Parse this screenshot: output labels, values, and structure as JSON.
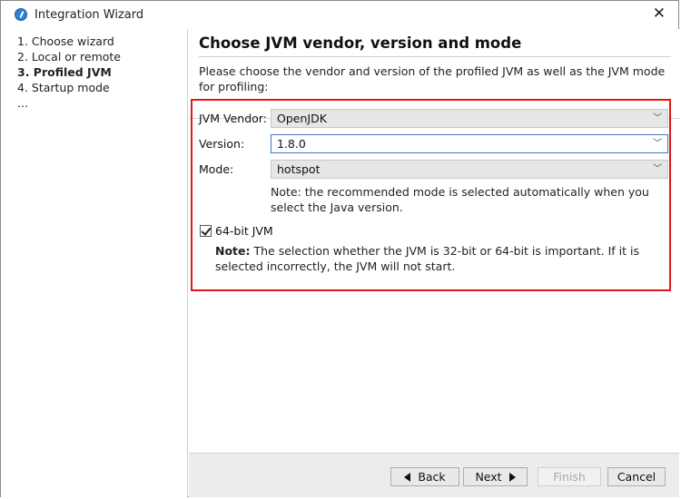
{
  "window": {
    "title": "Integration Wizard"
  },
  "sidebar": {
    "steps": [
      {
        "label": "1. Choose wizard"
      },
      {
        "label": "2. Local or remote"
      },
      {
        "label": "3. Profiled JVM"
      },
      {
        "label": "4. Startup mode"
      },
      {
        "label": "..."
      }
    ],
    "current_index": 2
  },
  "header": {
    "title": "Choose JVM vendor, version and mode",
    "description": "Please choose the vendor and version of the profiled JVM as well as the JVM mode for profiling:"
  },
  "form": {
    "vendor": {
      "label": "JVM Vendor:",
      "value": "OpenJDK"
    },
    "version": {
      "label": "Version:",
      "value": "1.8.0"
    },
    "mode": {
      "label": "Mode:",
      "value": "hotspot"
    },
    "mode_note": "Note: the recommended mode is selected automatically when you select the Java version.",
    "checkbox": {
      "label": "64-bit JVM",
      "checked": true
    },
    "bit_note_bold": "Note:",
    "bit_note_text": " The selection whether the JVM is 32-bit or 64-bit is important. If it is selected incorrectly, the JVM will not start."
  },
  "buttons": {
    "back": "Back",
    "next": "Next",
    "finish": "Finish",
    "cancel": "Cancel"
  },
  "colors": {
    "highlight_border": "#e01818",
    "focus_border": "#3a78c2"
  }
}
